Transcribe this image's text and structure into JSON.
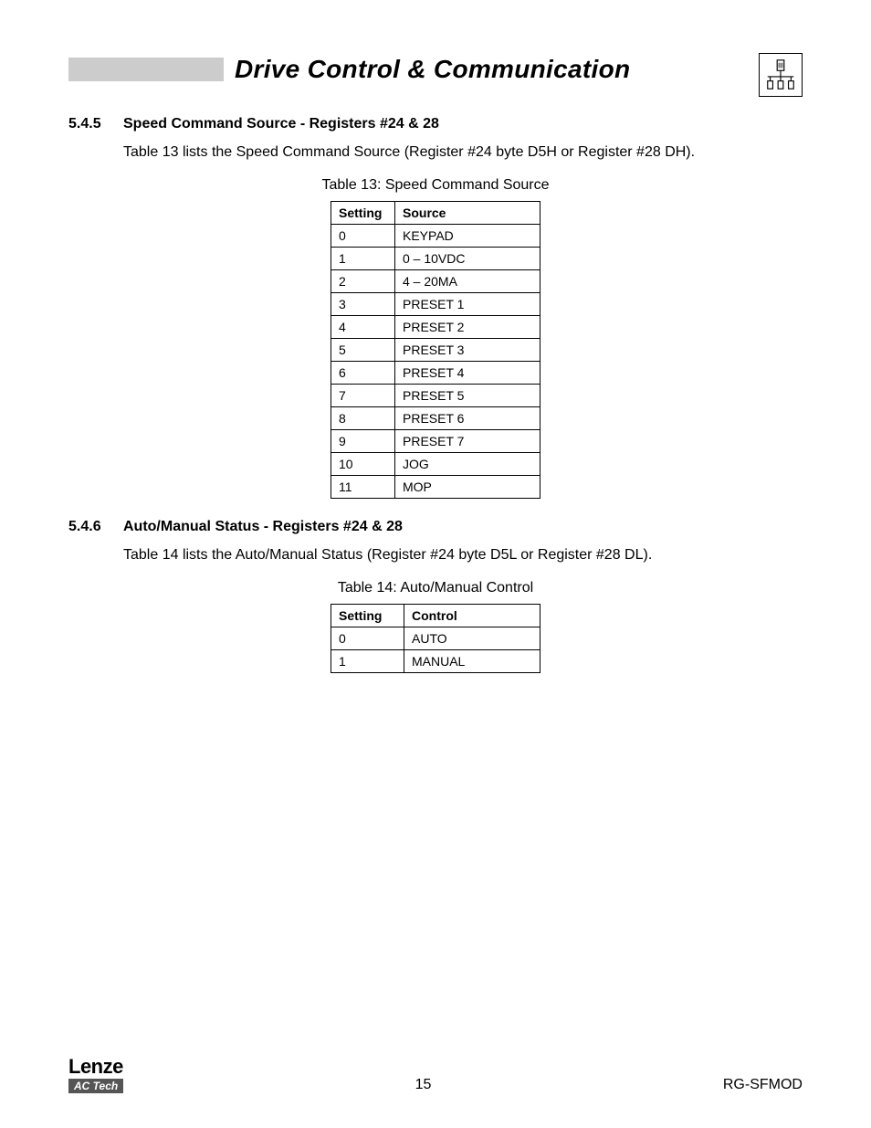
{
  "header": {
    "title": "Drive Control & Communication",
    "icon_name": "bus-network-icon"
  },
  "section1": {
    "number": "5.4.5",
    "title": "Speed Command Source - Registers #24 & 28",
    "body": "Table 13 lists the Speed Command Source (Register #24 byte D5H or Register #28 DH).",
    "table_caption": "Table 13: Speed Command Source",
    "headers": [
      "Setting",
      "Source"
    ],
    "rows": [
      [
        "0",
        "KEYPAD"
      ],
      [
        "1",
        "0 – 10VDC"
      ],
      [
        "2",
        "4 – 20MA"
      ],
      [
        "3",
        "PRESET 1"
      ],
      [
        "4",
        "PRESET 2"
      ],
      [
        "5",
        "PRESET 3"
      ],
      [
        "6",
        "PRESET 4"
      ],
      [
        "7",
        "PRESET 5"
      ],
      [
        "8",
        "PRESET 6"
      ],
      [
        "9",
        "PRESET 7"
      ],
      [
        "10",
        "JOG"
      ],
      [
        "11",
        "MOP"
      ]
    ]
  },
  "section2": {
    "number": "5.4.6",
    "title": "Auto/Manual Status - Registers #24 & 28",
    "body": "Table 14 lists the Auto/Manual Status (Register #24 byte D5L or Register #28 DL).",
    "table_caption": "Table 14: Auto/Manual Control",
    "headers": [
      "Setting",
      "Control"
    ],
    "rows": [
      [
        "0",
        "AUTO"
      ],
      [
        "1",
        "MANUAL"
      ]
    ]
  },
  "footer": {
    "logo_top": "Lenze",
    "logo_bottom": "AC Tech",
    "page_number": "15",
    "doc_code": "RG-SFMOD"
  }
}
